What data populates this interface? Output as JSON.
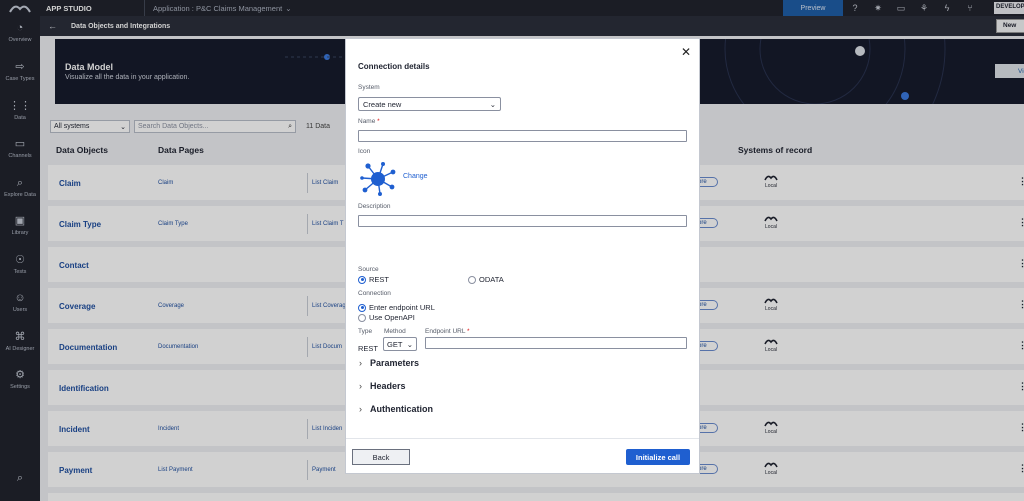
{
  "topbar": {
    "app_studio": "APP STUDIO",
    "application": "Application : P&C Claims Management",
    "preview": "Preview",
    "environment": "DEVELOP"
  },
  "nav": {
    "items": [
      {
        "label": "Overview",
        "icon": "gauge-icon"
      },
      {
        "label": "Case Types",
        "icon": "case-types-icon"
      },
      {
        "label": "Data",
        "icon": "data-grid-icon"
      },
      {
        "label": "Channels",
        "icon": "channels-icon"
      },
      {
        "label": "Explore Data",
        "icon": "explore-data-icon"
      },
      {
        "label": "Library",
        "icon": "library-icon"
      },
      {
        "label": "Tests",
        "icon": "tests-icon"
      },
      {
        "label": "Users",
        "icon": "users-icon"
      },
      {
        "label": "AI Designer",
        "icon": "ai-designer-icon"
      },
      {
        "label": "Settings",
        "icon": "settings-icon"
      }
    ]
  },
  "page": {
    "title": "Data Objects and Integrations",
    "new_button": "New",
    "banner_title": "Data Model",
    "banner_subtitle": "Visualize all the data in your application.",
    "view_button": "View",
    "filter_value": "All systems",
    "search_placeholder": "Search Data Objects...",
    "count": "11 Data",
    "columns": {
      "data_objects": "Data Objects",
      "data_pages": "Data Pages",
      "systems_of_record": "Systems of record"
    },
    "rows": [
      {
        "name": "Claim",
        "data_page": "Claim",
        "list_page": "List Claim",
        "store": "ore",
        "sor": "Local"
      },
      {
        "name": "Claim Type",
        "data_page": "Claim Type",
        "list_page": "List Claim T",
        "store": "ore",
        "sor": "Local"
      },
      {
        "name": "Contact",
        "data_page": "",
        "list_page": "",
        "store": "",
        "sor": ""
      },
      {
        "name": "Coverage",
        "data_page": "Coverage",
        "list_page": "List Coverag",
        "store": "ore",
        "sor": "Local"
      },
      {
        "name": "Documentation",
        "data_page": "Documentation",
        "list_page": "List Docum",
        "store": "ore",
        "sor": "Local"
      },
      {
        "name": "Identification",
        "data_page": "",
        "list_page": "",
        "store": "",
        "sor": ""
      },
      {
        "name": "Incident",
        "data_page": "Incident",
        "list_page": "List Inciden",
        "store": "ore",
        "sor": "Local"
      },
      {
        "name": "Payment",
        "data_page": "List Payment",
        "list_page": "Payment",
        "store": "ore",
        "sor": "Local"
      }
    ]
  },
  "modal": {
    "title": "Connection details",
    "system_label": "System",
    "system_value": "Create new",
    "name_label": "Name",
    "required_mark": "*",
    "icon_label": "Icon",
    "change_link": "Change",
    "description_label": "Description",
    "source_label": "Source",
    "source_options": [
      "REST",
      "ODATA"
    ],
    "source_selected": "REST",
    "connection_label": "Connection",
    "connection_options": [
      "Enter endpoint URL",
      "Use OpenAPI"
    ],
    "connection_selected": "Enter endpoint URL",
    "type_label": "Type",
    "type_value": "REST",
    "method_label": "Method",
    "method_value": "GET",
    "endpoint_label": "Endpoint URL",
    "sections": [
      "Parameters",
      "Headers",
      "Authentication"
    ],
    "back_button": "Back",
    "initialize_button": "Initialize call"
  },
  "colors": {
    "primary": "#1f5fd0",
    "nav_bg": "#21242e",
    "link": "#1f4fa0"
  }
}
